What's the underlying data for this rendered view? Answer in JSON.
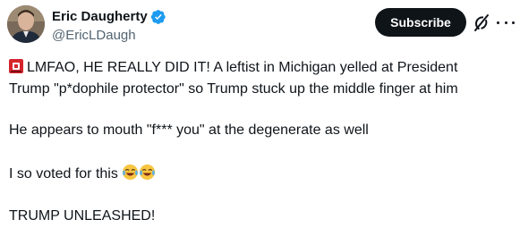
{
  "author": {
    "display_name": "Eric Daugherty",
    "handle": "@EricLDaugh",
    "verified_badge_color": "#1d9bf0"
  },
  "header_actions": {
    "subscribe_label": "Subscribe",
    "grok_icon": "grok-icon",
    "more_icon": "more-horizontal-icon"
  },
  "tweet": {
    "line1": "LMFAO, HE REALLY DID IT! A leftist in Michigan yelled at President",
    "line2": "Trump \"p*dophile protector\" so Trump stuck up the middle finger at him",
    "line3": "He appears to mouth \"f*** you\" at the degenerate as well",
    "line4": "I so voted for this",
    "line5": "TRUMP UNLEASHED!",
    "emojis": [
      "police-siren-emoji",
      "tears-of-joy-emoji",
      "tears-of-joy-emoji"
    ]
  },
  "colors": {
    "text": "#0f1419",
    "secondary": "#536471",
    "button_bg": "#0f1419",
    "button_text": "#ffffff"
  }
}
